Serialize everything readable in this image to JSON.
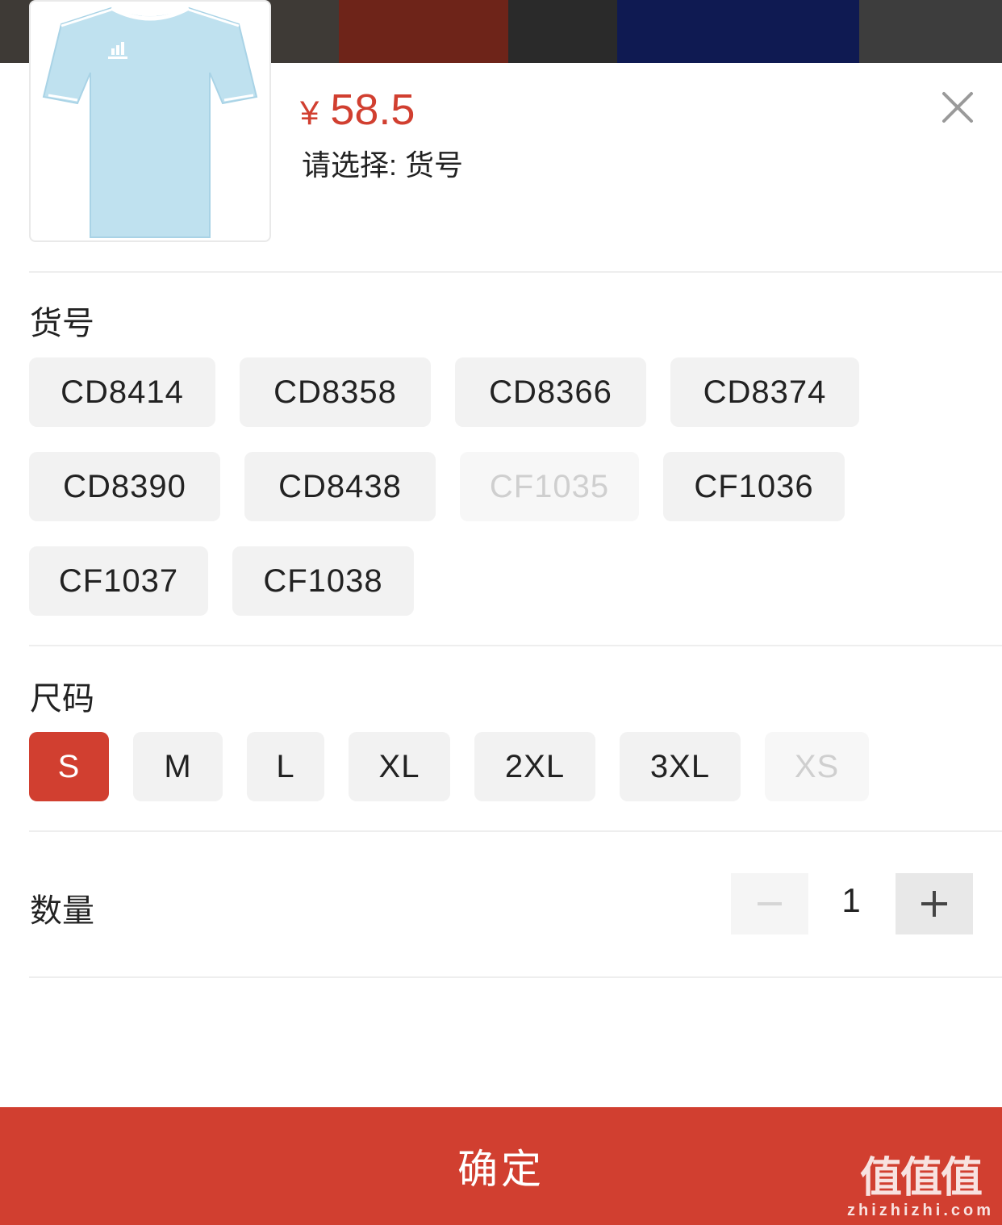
{
  "product": {
    "currency_symbol": "¥",
    "price": "58.5",
    "prompt": "请选择: 货号"
  },
  "sections": {
    "article_title": "货号",
    "size_title": "尺码",
    "quantity_title": "数量"
  },
  "articles": [
    {
      "label": "CD8414",
      "state": "normal"
    },
    {
      "label": "CD8358",
      "state": "normal"
    },
    {
      "label": "CD8366",
      "state": "normal"
    },
    {
      "label": "CD8374",
      "state": "normal"
    },
    {
      "label": "CD8390",
      "state": "normal"
    },
    {
      "label": "CD8438",
      "state": "normal"
    },
    {
      "label": "CF1035",
      "state": "disabled"
    },
    {
      "label": "CF1036",
      "state": "normal"
    },
    {
      "label": "CF1037",
      "state": "normal"
    },
    {
      "label": "CF1038",
      "state": "normal"
    }
  ],
  "sizes": [
    {
      "label": "S",
      "state": "selected"
    },
    {
      "label": "M",
      "state": "normal"
    },
    {
      "label": "L",
      "state": "normal"
    },
    {
      "label": "XL",
      "state": "normal"
    },
    {
      "label": "2XL",
      "state": "normal"
    },
    {
      "label": "3XL",
      "state": "normal"
    },
    {
      "label": "XS",
      "state": "disabled"
    }
  ],
  "quantity": {
    "value": "1"
  },
  "confirm_label": "确定",
  "watermark": {
    "brand": "值值值",
    "url": "zhizhizhi.com"
  },
  "colors": {
    "accent": "#d13f30",
    "chip_bg": "#f2f2f2",
    "shirt": "#bfe1ef"
  }
}
